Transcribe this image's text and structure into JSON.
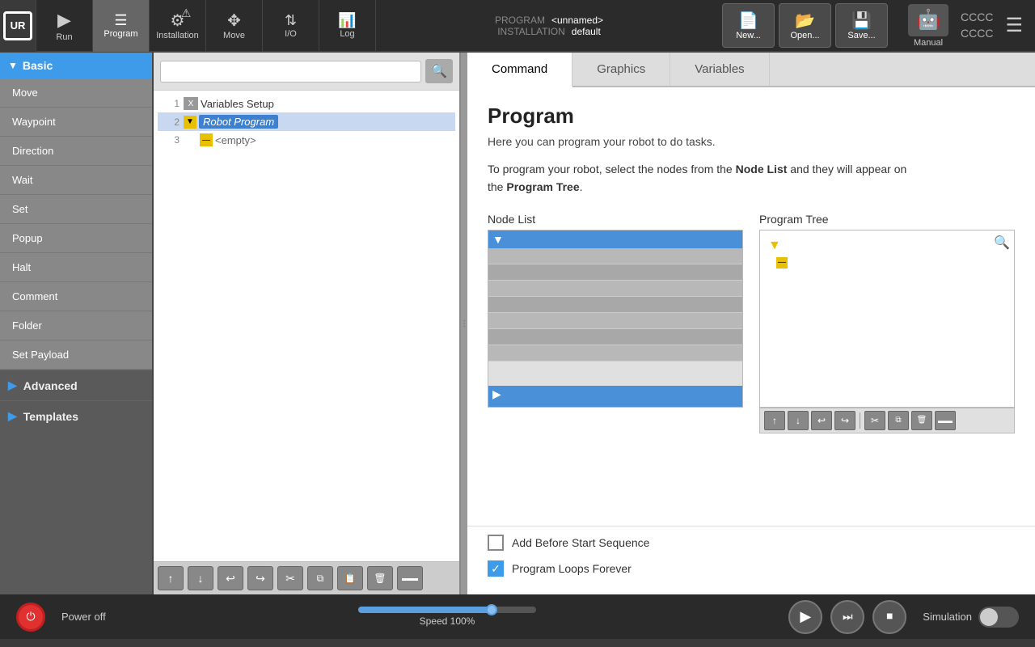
{
  "toolbar": {
    "run_label": "Run",
    "program_label": "Program",
    "installation_label": "Installation",
    "move_label": "Move",
    "io_label": "I/O",
    "log_label": "Log",
    "program_name": "<unnamed>",
    "installation_name": "default",
    "new_label": "New...",
    "open_label": "Open...",
    "save_label": "Save...",
    "manual_label": "Manual",
    "cccc1": "CCCC",
    "cccc2": "CCCC",
    "prog_label": "PROGRAM",
    "inst_label": "INSTALLATION"
  },
  "sidebar": {
    "basic_label": "Basic",
    "items": [
      {
        "label": "Move"
      },
      {
        "label": "Waypoint"
      },
      {
        "label": "Direction"
      },
      {
        "label": "Wait"
      },
      {
        "label": "Set"
      },
      {
        "label": "Popup"
      },
      {
        "label": "Halt"
      },
      {
        "label": "Comment"
      },
      {
        "label": "Folder"
      },
      {
        "label": "Set Payload"
      }
    ],
    "advanced_label": "Advanced",
    "templates_label": "Templates"
  },
  "center": {
    "search_placeholder": "",
    "tree_lines": [
      {
        "num": "1",
        "type": "x",
        "label": "Variables Setup",
        "indent": 0
      },
      {
        "num": "2",
        "type": "yellow",
        "label": "Robot Program",
        "indent": 0,
        "selected": true
      },
      {
        "num": "3",
        "type": "dash",
        "label": "<empty>",
        "indent": 1
      }
    ]
  },
  "panel_toolbar": {
    "up_label": "↑",
    "down_label": "↓",
    "undo_label": "↩",
    "redo_label": "↪",
    "cut_label": "✂",
    "copy_label": "⧉",
    "paste_label": "⏋",
    "delete_label": "🗑",
    "more_label": "▬"
  },
  "tabs": {
    "command_label": "Command",
    "graphics_label": "Graphics",
    "variables_label": "Variables"
  },
  "command": {
    "title": "Program",
    "subtitle": "Here you can program your robot to do tasks.",
    "description_part1": "To program your robot, select the nodes from the ",
    "node_list_bold": "Node List",
    "description_part2": " and they will appear on\nthe ",
    "program_tree_bold": "Program Tree",
    "description_part3": ".",
    "node_list_title": "Node List",
    "program_tree_title": "Program Tree"
  },
  "checkboxes": {
    "add_before_label": "Add Before Start Sequence",
    "loops_label": "Program Loops Forever",
    "add_before_checked": false,
    "loops_checked": true
  },
  "status_bar": {
    "power_label": "Power off",
    "speed_label": "Speed 100%",
    "simulation_label": "Simulation"
  }
}
